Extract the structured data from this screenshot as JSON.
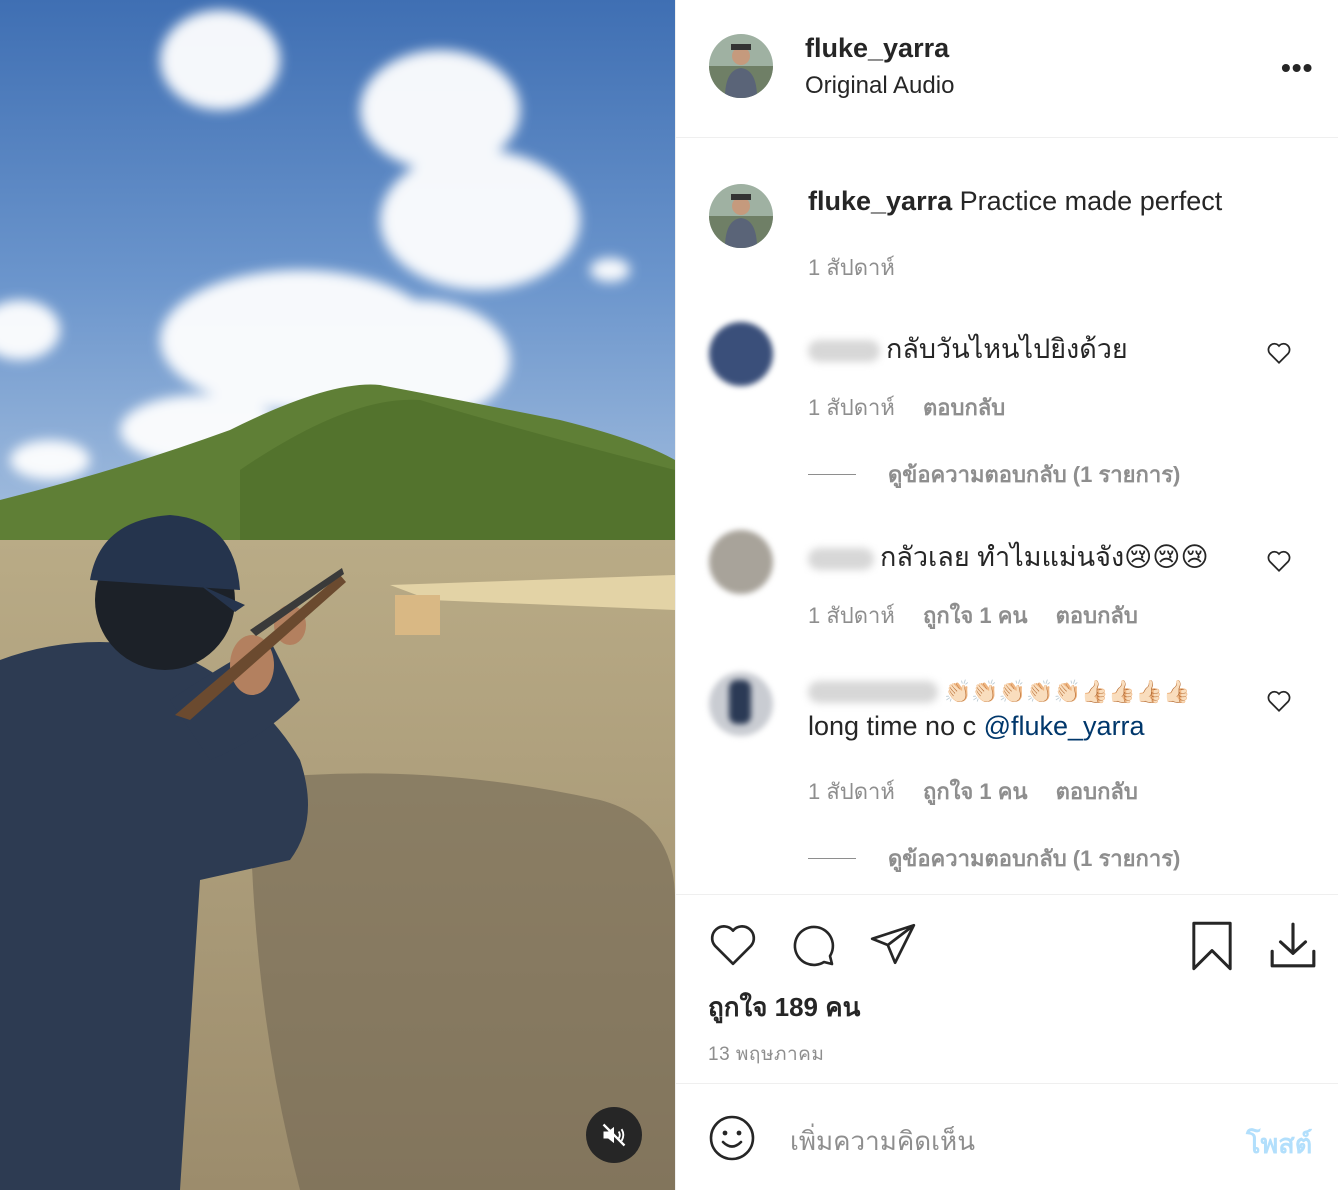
{
  "header": {
    "username": "fluke_yarra",
    "audio": "Original Audio",
    "more_label": "•••"
  },
  "caption": {
    "username": "fluke_yarra",
    "text": "Practice made perfect",
    "time": "1 สัปดาห์"
  },
  "comments": [
    {
      "text": "กลับวันไหนไปยิงด้วย",
      "time": "1 สัปดาห์",
      "likes": "",
      "reply": "ตอบกลับ",
      "view_replies": "ดูข้อความตอบกลับ (1 รายการ)"
    },
    {
      "text": "กลัวเลย ทำไมแม่นจัง😢😢😢",
      "time": "1 สัปดาห์",
      "likes": "ถูกใจ 1 คน",
      "reply": "ตอบกลับ",
      "view_replies": ""
    },
    {
      "text_line1": "👏🏻👏🏻👏🏻👏🏻👏🏻👍🏻👍🏻👍🏻👍🏻",
      "text_line2": "long time no c ",
      "mention": "@fluke_yarra",
      "time": "1 สัปดาห์",
      "likes": "ถูกใจ 1 คน",
      "reply": "ตอบกลับ",
      "view_replies": "ดูข้อความตอบกลับ (1 รายการ)"
    }
  ],
  "likes_text": "ถูกใจ 189 คน",
  "date": "13 พฤษภาคม",
  "comment_box": {
    "placeholder": "เพิ่มความคิดเห็น",
    "post_label": "โพสต์"
  },
  "icons": {
    "like": "heart-icon",
    "comment": "comment-bubble-icon",
    "share": "paper-plane-icon",
    "save": "bookmark-icon",
    "download": "download-icon",
    "emoji": "smiley-icon",
    "mute": "speaker-muted-icon"
  },
  "colors": {
    "link": "#00376b",
    "muted": "#8e8e8e",
    "post_disabled": "#b2dffc"
  }
}
